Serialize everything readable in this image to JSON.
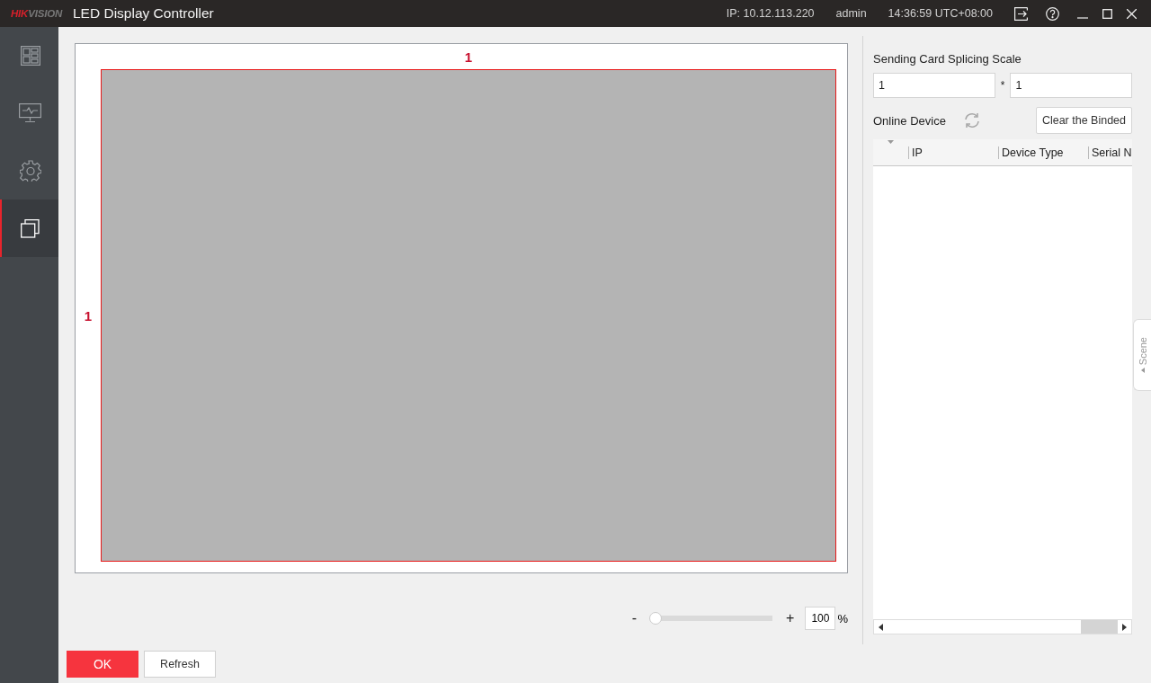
{
  "window": {
    "logo": [
      "HIK",
      "VISION"
    ],
    "title": "LED Display Controller",
    "ip": "IP: 10.12.113.220",
    "user": "admin",
    "time": "14:36:59 UTC+08:00"
  },
  "sidebar": {
    "items": [
      {
        "kind": "layout",
        "selected": false
      },
      {
        "kind": "monitor",
        "selected": false
      },
      {
        "kind": "settings",
        "selected": false
      },
      {
        "kind": "windows",
        "selected": true
      }
    ]
  },
  "canvas": {
    "column_label": "1",
    "row_label": "1"
  },
  "zoom": {
    "minus": "-",
    "plus": "+",
    "level": 0,
    "value": "100",
    "unit": "%"
  },
  "splicing": {
    "title": "Sending Card Splicing Scale",
    "columns": "1",
    "separator": "*",
    "rows": "1"
  },
  "online_device": {
    "title": "Online Device",
    "clear_button": "Clear the Binded",
    "columns": [
      "IP",
      "Device Type",
      "Serial N"
    ]
  },
  "scene_tab": "Scene",
  "buttons": {
    "ok": "OK",
    "refresh": "Refresh"
  }
}
